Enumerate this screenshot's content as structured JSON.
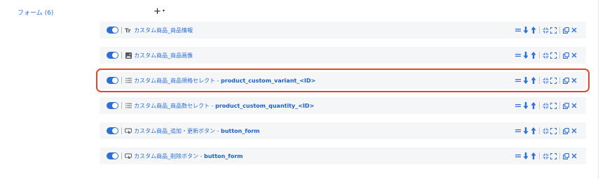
{
  "section": {
    "label": "フォーム (6)"
  },
  "add_button": {
    "plus": "+",
    "caret": "▾"
  },
  "rows": [
    {
      "prefix": "カスタム商品_商品情報",
      "separator": "",
      "code": "",
      "icon": "text-tr-icon",
      "selected": false
    },
    {
      "prefix": "カスタム商品_商品画像",
      "separator": "",
      "code": "",
      "icon": "image-icon",
      "selected": false
    },
    {
      "prefix": "カスタム商品_商品規格セレクト",
      "separator": " - ",
      "code": "product_custom_variant_<ID>",
      "icon": "list-icon",
      "selected": true
    },
    {
      "prefix": "カスタム商品_商品数セレクト",
      "separator": " - ",
      "code": "product_custom_quantity_<ID>",
      "icon": "list-icon",
      "selected": false
    },
    {
      "prefix": "カスタム商品_追加・更新ボタン",
      "separator": " - ",
      "code": "button_form",
      "icon": "button-icon",
      "selected": false
    },
    {
      "prefix": "カスタム商品_削除ボタン",
      "separator": " - ",
      "code": "button_form",
      "icon": "button-icon",
      "selected": false
    }
  ],
  "colors": {
    "accent": "#2d6fd6",
    "selected_outline": "#e0482c",
    "row_bg": "#f5f6f8"
  }
}
